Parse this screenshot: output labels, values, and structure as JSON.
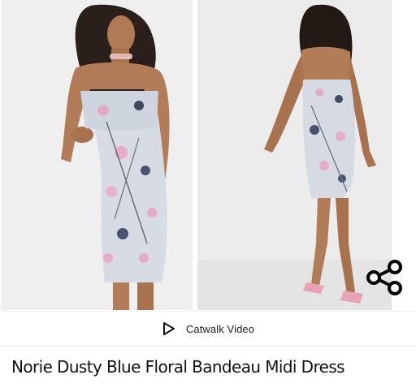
{
  "gallery": {
    "images": [
      {
        "alt": "front view"
      },
      {
        "alt": "back view"
      }
    ],
    "share_icon": "share-icon"
  },
  "video": {
    "icon": "play-icon",
    "label": "Catwalk Video"
  },
  "product": {
    "title": "Norie Dusty Blue Floral Bandeau Midi Dress"
  }
}
